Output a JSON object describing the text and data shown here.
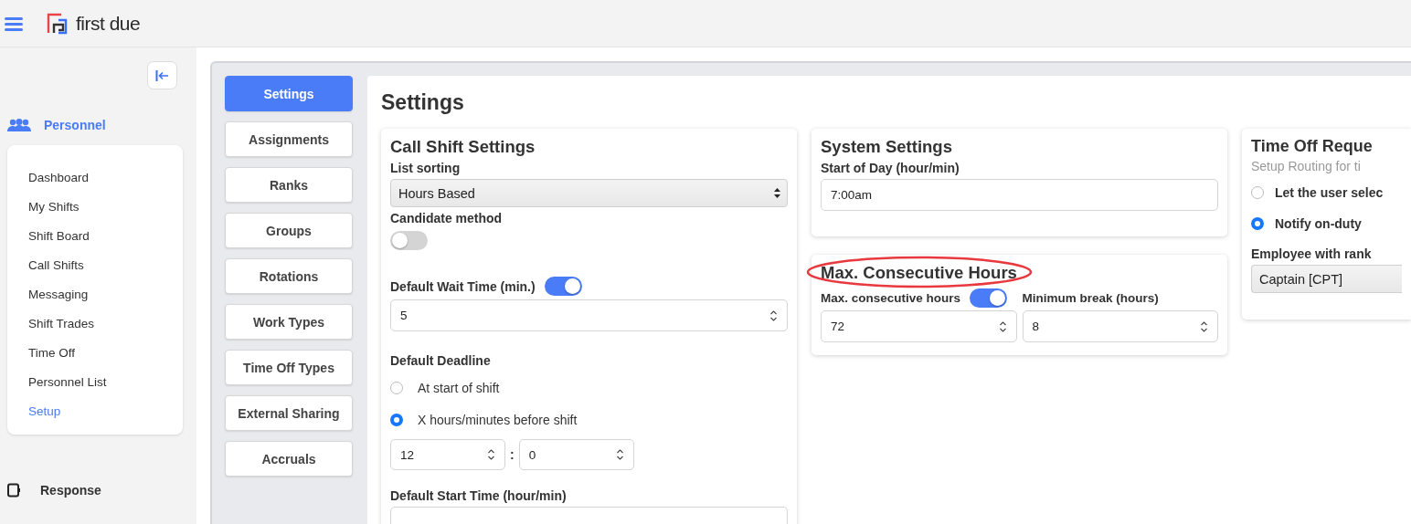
{
  "header": {
    "logo_text": "first due"
  },
  "sidebar": {
    "sections": [
      {
        "kind": "people",
        "label": "Personnel",
        "selected": true,
        "items": [
          {
            "label": "Dashboard",
            "selected": false
          },
          {
            "label": "My Shifts",
            "selected": false
          },
          {
            "label": "Shift Board",
            "selected": false
          },
          {
            "label": "Call Shifts",
            "selected": false
          },
          {
            "label": "Messaging",
            "selected": false
          },
          {
            "label": "Shift Trades",
            "selected": false
          },
          {
            "label": "Time Off",
            "selected": false
          },
          {
            "label": "Personnel List",
            "selected": false
          },
          {
            "label": "Setup",
            "selected": true
          }
        ]
      },
      {
        "kind": "device",
        "label": "Response",
        "selected": false
      }
    ]
  },
  "tabs": [
    {
      "label": "Settings",
      "selected": true
    },
    {
      "label": "Assignments",
      "selected": false
    },
    {
      "label": "Ranks",
      "selected": false
    },
    {
      "label": "Groups",
      "selected": false
    },
    {
      "label": "Rotations",
      "selected": false
    },
    {
      "label": "Work Types",
      "selected": false
    },
    {
      "label": "Time Off Types",
      "selected": false
    },
    {
      "label": "External Sharing",
      "selected": false
    },
    {
      "label": "Accruals",
      "selected": false
    }
  ],
  "page_title": "Settings",
  "columns": [
    [
      {
        "title": "Call Shift Settings",
        "fields": [
          {
            "kind": "select",
            "label": "List sorting",
            "value": "Hours Based"
          },
          {
            "kind": "toggle",
            "label": "Candidate method",
            "on": false
          },
          {
            "kind": "number",
            "label": "Default Wait Time (min.)",
            "toggle_on": true,
            "value": "5"
          },
          {
            "kind": "radio_group",
            "label": "Default Deadline",
            "options": [
              {
                "label": "At start of shift",
                "selected": false
              },
              {
                "label": "X hours/minutes before shift",
                "selected": true
              }
            ]
          },
          {
            "kind": "number_pair",
            "separator": ":",
            "values": [
              "12",
              "0"
            ]
          },
          {
            "kind": "text",
            "label": "Default Start Time (hour/min)"
          }
        ]
      }
    ],
    [
      {
        "title": "System Settings",
        "fields": [
          {
            "kind": "text",
            "label": "Start of Day (hour/min)",
            "value": "7:00am"
          }
        ]
      },
      {
        "title": "Max. Consecutive Hours",
        "highlighted": true,
        "fields": [
          {
            "kind": "row",
            "fields": [
              {
                "kind": "number",
                "label": "Max. consecutive hours",
                "toggle_on": true,
                "value": "72"
              },
              {
                "kind": "number",
                "label": "Minimum break (hours)",
                "value": "8"
              }
            ]
          }
        ]
      }
    ],
    [
      {
        "title": "Time Off Reque",
        "subtitle": "Setup Routing for ti",
        "fields": [
          {
            "kind": "radio_group",
            "options": [
              {
                "label": "Let the user selec",
                "selected": false
              },
              {
                "label": "Notify on-duty",
                "selected": true
              }
            ]
          },
          {
            "kind": "select",
            "label": "Employee with rank",
            "value": "Captain [CPT]"
          }
        ]
      }
    ]
  ]
}
